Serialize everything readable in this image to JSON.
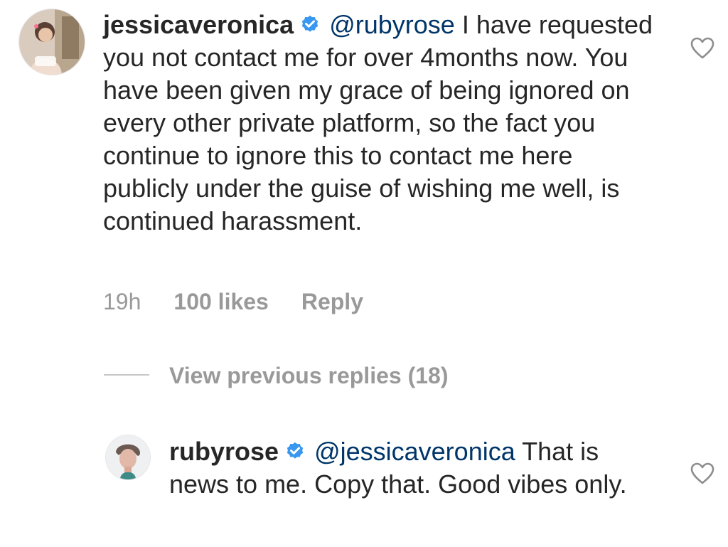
{
  "comments": [
    {
      "username": "jessicaveronica",
      "verified": true,
      "mention": "@rubyrose",
      "text": " I have requested you not contact me for over 4months now. You have been given my grace of being ignored on every other private platform, so the fact you continue to ignore this to contact me here publicly under the guise of wishing me well, is continued harassment.",
      "time": "19h",
      "likes": "100 likes",
      "reply_label": "Reply"
    },
    {
      "username": "rubyrose",
      "verified": true,
      "mention": "@jessicaveronica",
      "text": " That is news to me. Copy that. Good vibes only."
    }
  ],
  "view_replies_label": "View previous replies (18)",
  "icons": {
    "verified": "verified-badge-icon",
    "like": "heart-outline-icon"
  },
  "colors": {
    "text": "#262626",
    "mention": "#003569",
    "meta": "#999999",
    "verified": "#3897f0"
  }
}
